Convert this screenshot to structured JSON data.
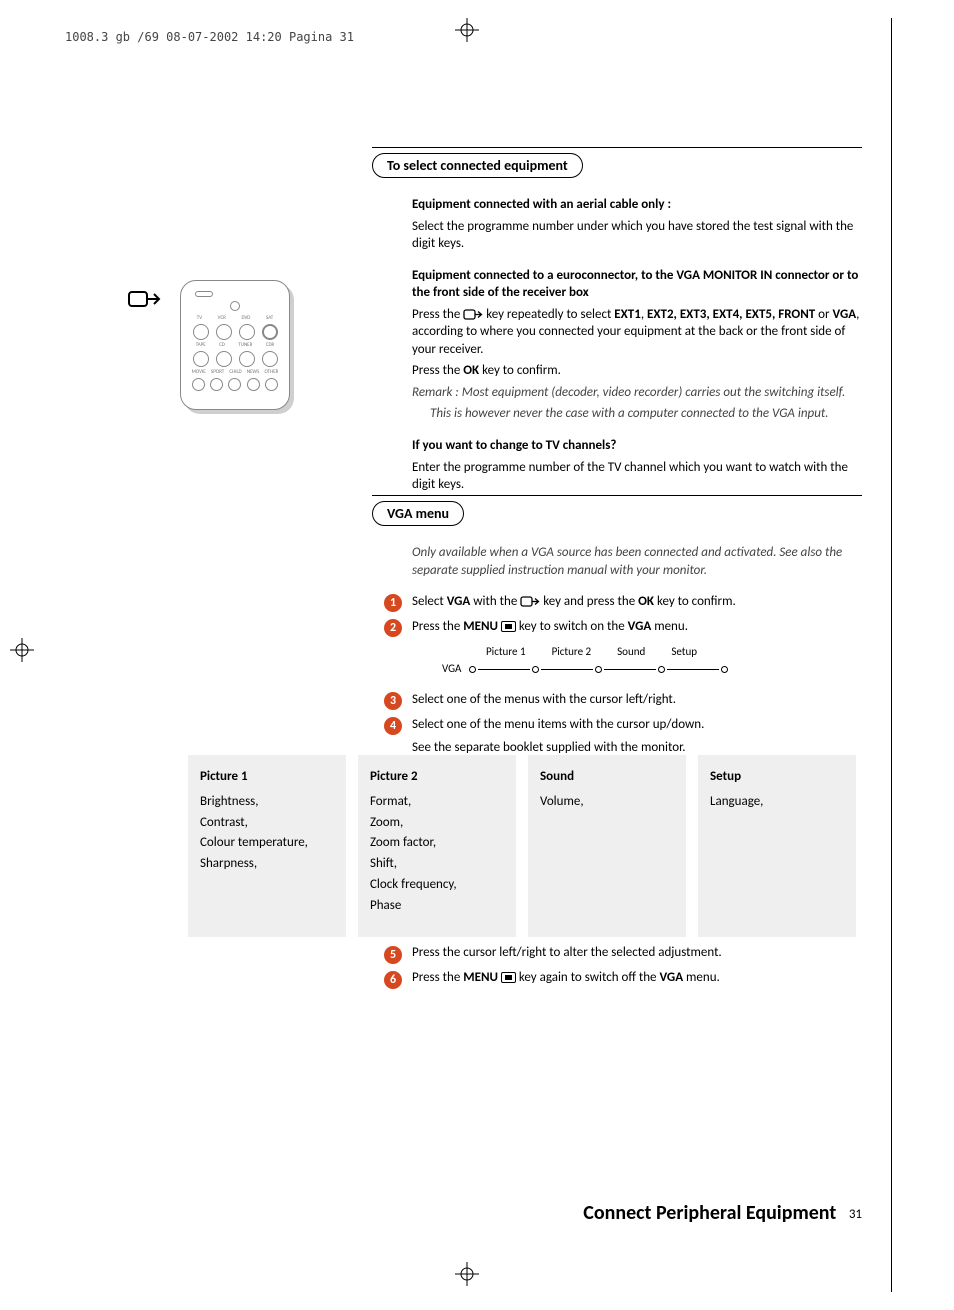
{
  "header_line": "1008.3 gb /69  08-07-2002  14:20  Pagina 31",
  "section1": {
    "title": "To select connected equipment",
    "blocks": {
      "aerial_heading": "Equipment connected with an aerial cable only :",
      "aerial_body": "Select the programme number under which you have stored the test signal with the digit keys.",
      "euro_heading_a": "Equipment connected to a euroconnector, to the ",
      "euro_heading_b": "VGA MONITOR IN",
      "euro_heading_c": " connector or to the front side of the receiver box",
      "euro_l1a": "Press the ",
      "euro_l1b": " key repeatedly to select ",
      "euro_l1c": "EXT1",
      "euro_l1d": ", ",
      "euro_l1e": "EXT2, EXT3, EXT4, EXT5, FRONT",
      "euro_l1f": " or ",
      "euro_l1g": "VGA",
      "euro_l1h": ", according to where you connected your equipment at the back or the front side of your receiver.",
      "euro_l2a": "Press the ",
      "euro_l2b": "OK",
      "euro_l2c": " key to confirm.",
      "remark1": "Remark : Most equipment (decoder, video recorder) carries out the switching itself.",
      "remark2": "This is however never the case with a computer connected to the VGA input.",
      "change_heading": "If you want to change to TV channels?",
      "change_body": "Enter the programme number of the TV channel which you want to watch with the digit keys."
    }
  },
  "remote_labels": {
    "row1": [
      "TV",
      "VCR",
      "DVD",
      "SAT"
    ],
    "row2": [
      "TAPE",
      "CD",
      "TUNER",
      "CDR"
    ],
    "row3": [
      "MOVIE",
      "SPORT",
      "CHILD",
      "NEWS",
      "OTHER"
    ]
  },
  "section2": {
    "title": "VGA menu",
    "intro": "Only available when a VGA source has been connected and activated. See also the separate supplied instruction manual with your monitor.",
    "steps": {
      "s1a": "Select ",
      "s1b": "VGA",
      "s1c": " with the ",
      "s1d": " key and press the ",
      "s1e": "OK",
      "s1f": " key to confirm.",
      "s2a": "Press the ",
      "s2b": "MENU",
      "s2c": " key to switch on the ",
      "s2d": "VGA",
      "s2e": " menu.",
      "s3": "Select one of the menus with the cursor left/right.",
      "s4": "Select one of the menu items with the cursor up/down.",
      "s4b": "See the separate booklet supplied with the monitor.",
      "s5": "Press the cursor left/right to alter the selected adjustment.",
      "s6a": "Press the ",
      "s6b": "MENU",
      "s6c": " key again to switch off the ",
      "s6d": "VGA",
      "s6e": " menu."
    },
    "diagram": {
      "root": "VGA",
      "items": [
        "Picture 1",
        "Picture 2",
        "Sound",
        "Setup"
      ]
    }
  },
  "columns": {
    "c1_title": "Picture 1",
    "c1_items": [
      "Brightness,",
      "Contrast,",
      "Colour temperature,",
      "Sharpness,"
    ],
    "c2_title": "Picture 2",
    "c2_items": [
      "Format,",
      "Zoom,",
      "Zoom factor,",
      "Shift,",
      "Clock frequency,",
      "Phase"
    ],
    "c3_title": "Sound",
    "c3_items": [
      "Volume,"
    ],
    "c4_title": "Setup",
    "c4_items": [
      "Language,"
    ]
  },
  "footer": {
    "title": "Connect Peripheral Equipment",
    "page": "31"
  }
}
